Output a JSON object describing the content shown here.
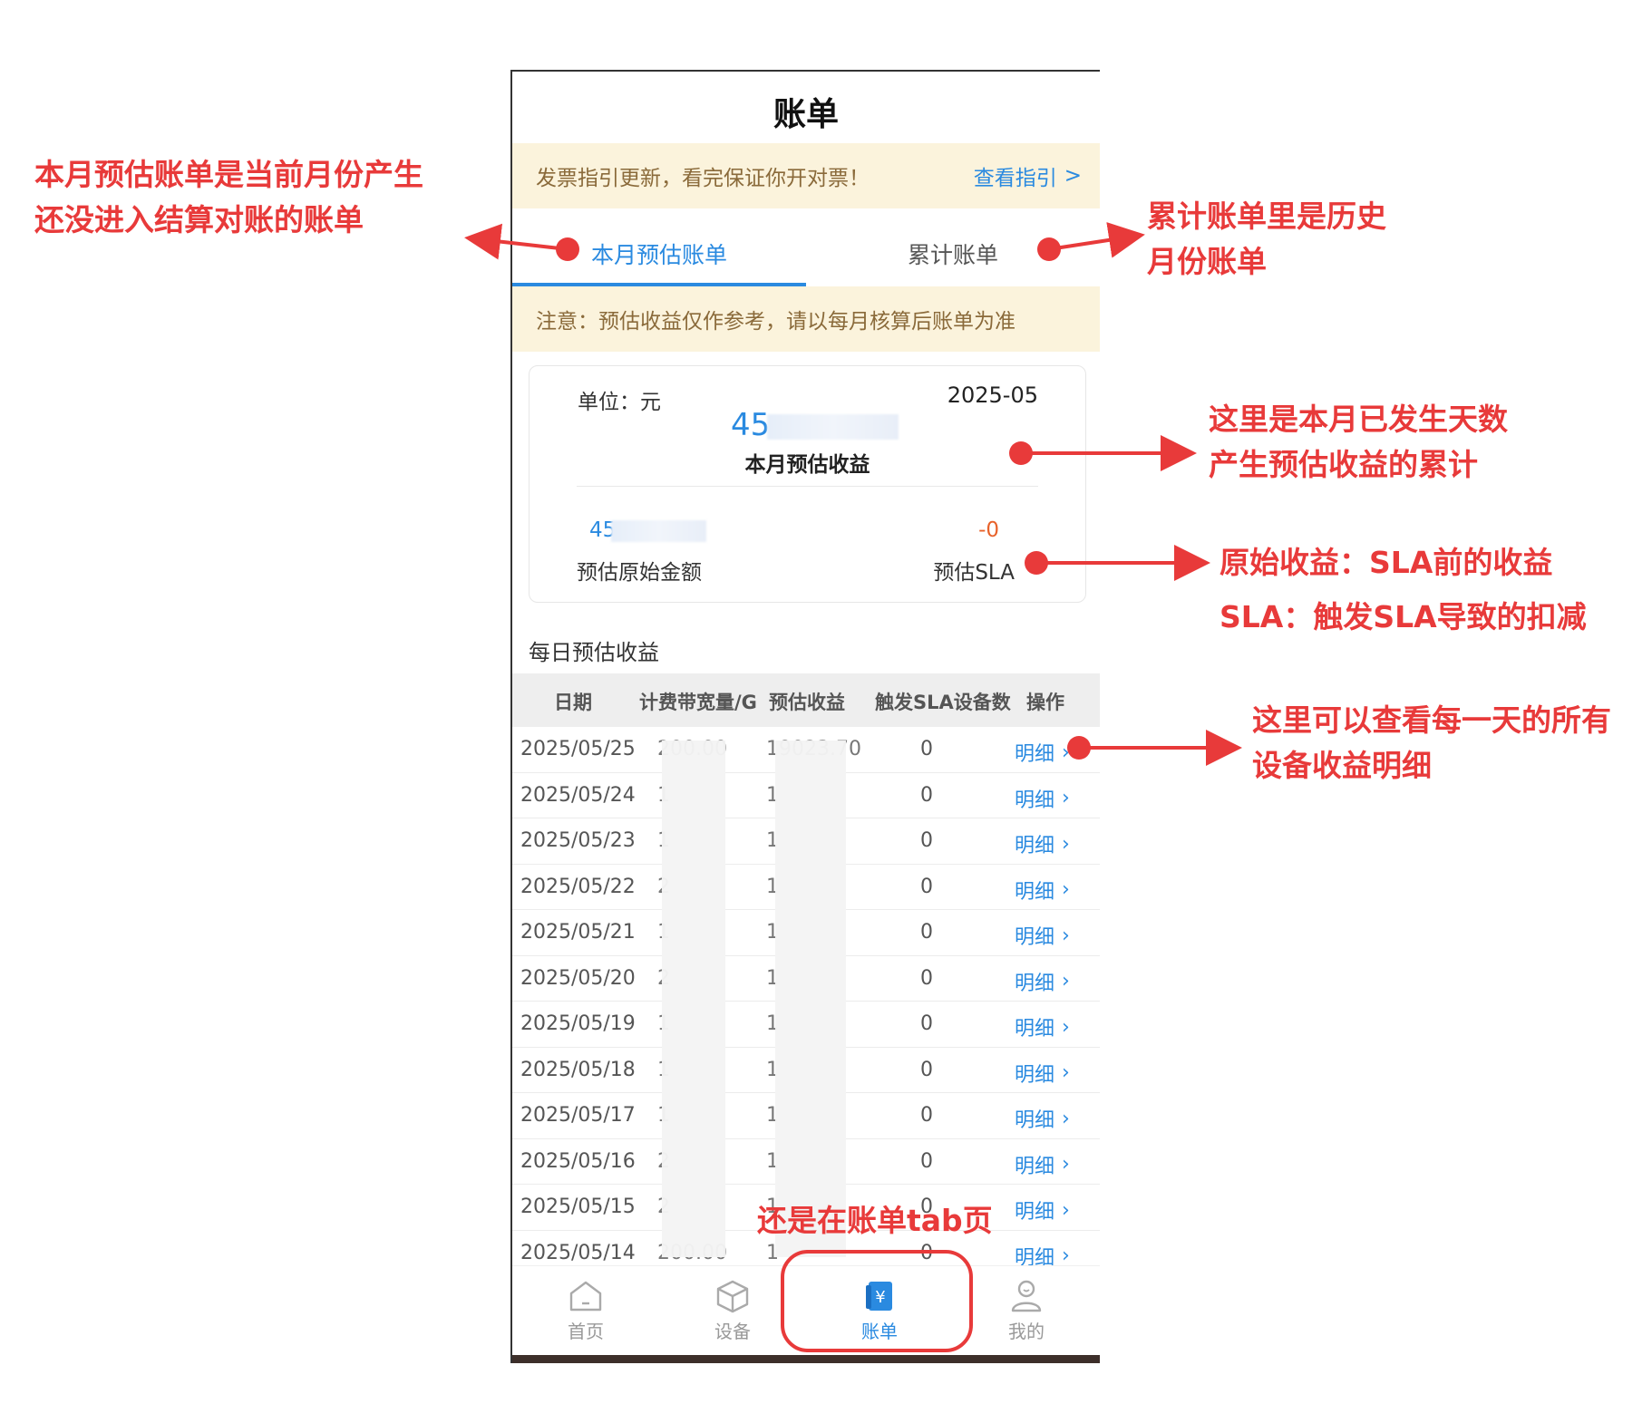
{
  "app": {
    "title": "账单",
    "banner": {
      "text": "发票指引更新，看完保证你开对票！",
      "link_label": "查看指引"
    },
    "tabs": [
      {
        "label": "本月预估账单",
        "active": true
      },
      {
        "label": "累计账单",
        "active": false
      }
    ],
    "notice": "注意：预估收益仅作参考，请以每月核算后账单为准",
    "summary": {
      "unit_label": "单位：元",
      "month": "2025-05",
      "estimated_income_value": "45",
      "estimated_income_label": "本月预估收益",
      "original_amount_value": "45",
      "original_amount_label": "预估原始金额",
      "sla_value": "-0",
      "sla_label": "预估SLA"
    },
    "daily_section_title": "每日预估收益",
    "table": {
      "headers": [
        "日期",
        "计费带宽量/G",
        "预估收益",
        "触发SLA设备数",
        "操作"
      ],
      "rows": [
        {
          "date": "2025/05/25",
          "bandwidth": "200.00",
          "income": "19023.70",
          "sla_count": "0",
          "action": "明细"
        },
        {
          "date": "2025/05/24",
          "bandwidth": "1",
          "income": "1",
          "sla_count": "0",
          "action": "明细"
        },
        {
          "date": "2025/05/23",
          "bandwidth": "1",
          "income": "1",
          "sla_count": "0",
          "action": "明细"
        },
        {
          "date": "2025/05/22",
          "bandwidth": "2",
          "income": "1",
          "sla_count": "0",
          "action": "明细"
        },
        {
          "date": "2025/05/21",
          "bandwidth": "1",
          "income": "1",
          "sla_count": "0",
          "action": "明细"
        },
        {
          "date": "2025/05/20",
          "bandwidth": "2",
          "income": "1",
          "sla_count": "0",
          "action": "明细"
        },
        {
          "date": "2025/05/19",
          "bandwidth": "1",
          "income": "1",
          "sla_count": "0",
          "action": "明细"
        },
        {
          "date": "2025/05/18",
          "bandwidth": "1",
          "income": "1",
          "sla_count": "0",
          "action": "明细"
        },
        {
          "date": "2025/05/17",
          "bandwidth": "1",
          "income": "1",
          "sla_count": "0",
          "action": "明细"
        },
        {
          "date": "2025/05/16",
          "bandwidth": "2",
          "income": "1",
          "sla_count": "0",
          "action": "明细"
        },
        {
          "date": "2025/05/15",
          "bandwidth": "2",
          "income": "1",
          "sla_count": "0",
          "action": "明细"
        },
        {
          "date": "2025/05/14",
          "bandwidth": "200.00",
          "income": "1",
          "sla_count": "0",
          "action": "明细"
        }
      ]
    },
    "tabbar": [
      {
        "label": "首页",
        "icon": "home-icon",
        "active": false
      },
      {
        "label": "设备",
        "icon": "device-box-icon",
        "active": false
      },
      {
        "label": "账单",
        "icon": "bill-yuan-icon",
        "active": true
      },
      {
        "label": "我的",
        "icon": "user-icon",
        "active": false
      }
    ]
  },
  "annotations": {
    "monthly_bill": [
      "本月预估账单是当前月份产生",
      "还没进入结算对账的账单"
    ],
    "cumulative_bill": [
      "累计账单里是历史",
      "月份账单"
    ],
    "monthly_income": [
      "这里是本月已发生天数",
      "产生预估收益的累计"
    ],
    "original_income": "原始收益：SLA前的收益",
    "sla_explain": "SLA：触发SLA导致的扣减",
    "detail": [
      "这里可以查看每一天的所有",
      "设备收益明细"
    ],
    "tab_note": "还是在账单tab页"
  },
  "colors": {
    "accent": "#2a8ae0",
    "annotation": "#e83a3a",
    "banner_bg": "#fbf3dc",
    "negative": "#e8622a"
  }
}
